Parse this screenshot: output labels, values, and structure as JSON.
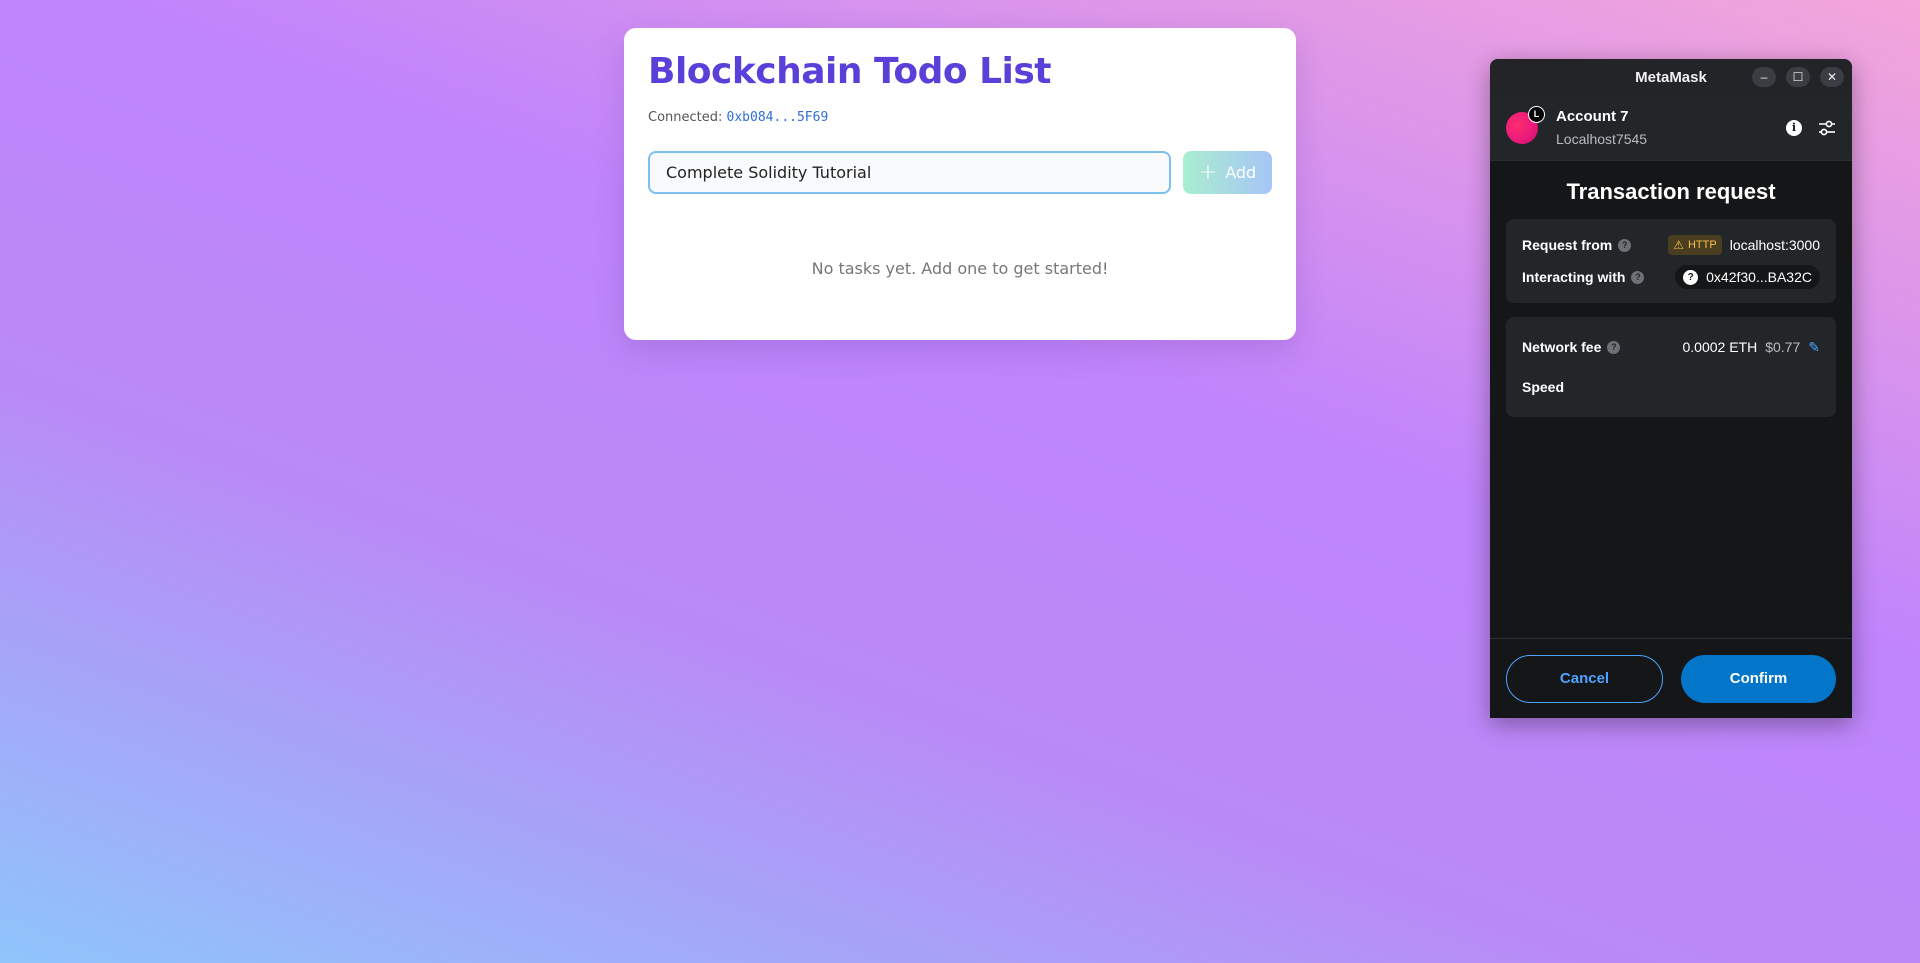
{
  "todo": {
    "title": "Blockchain Todo List",
    "connected_label": "Connected:",
    "connected_address": "0xb084...5F69",
    "input_value": "Complete Solidity Tutorial",
    "add_label": "Add",
    "empty_message": "No tasks yet. Add one to get started!"
  },
  "metamask": {
    "window_title": "MetaMask",
    "window_controls": [
      "–",
      "☐",
      "✕"
    ],
    "account": {
      "name": "Account 7",
      "network": "Localhost7545",
      "badge": "L"
    },
    "heading": "Transaction request",
    "request_from_label": "Request from",
    "http_badge": "HTTP",
    "request_origin": "localhost:3000",
    "interacting_with_label": "Interacting with",
    "contract_address": "0x42f30...BA32C",
    "network_fee_label": "Network fee",
    "fee_eth": "0.0002 ETH",
    "fee_usd": "$0.77",
    "speed_label": "Speed",
    "cancel_label": "Cancel",
    "confirm_label": "Confirm"
  },
  "colors": {
    "title": "#5b3fd9",
    "link": "#2f6fd6",
    "mm_primary": "#0376c9",
    "mm_accent": "#4da3ff"
  }
}
